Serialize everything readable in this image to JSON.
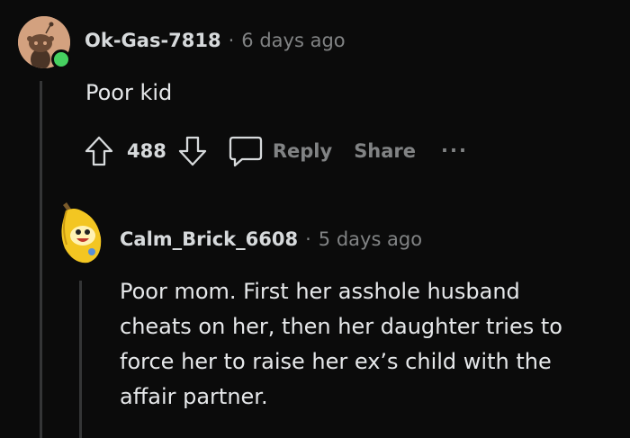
{
  "comments": [
    {
      "username": "Ok-Gas-7818",
      "separator": "·",
      "timestamp": "6 days ago",
      "body": "Poor kid",
      "votes": "488",
      "actions": {
        "reply": "Reply",
        "share": "Share",
        "more": "..."
      },
      "avatar_icon": "snoo-avatar-icon",
      "online_status": "online"
    },
    {
      "username": "Calm_Brick_6608",
      "separator": "·",
      "timestamp": "5 days ago",
      "body_lines": [
        "Poor mom. First her asshole husband",
        "cheats on her, then her daughter tries to",
        "force her to raise her ex’s child with the",
        "affair partner."
      ],
      "avatar_icon": "banana-avatar-icon"
    }
  ],
  "colors": {
    "background": "#0b0b0b",
    "text_primary": "#d7dadc",
    "text_muted": "#818384",
    "thread_line": "#343536",
    "online_green": "#46d160"
  }
}
